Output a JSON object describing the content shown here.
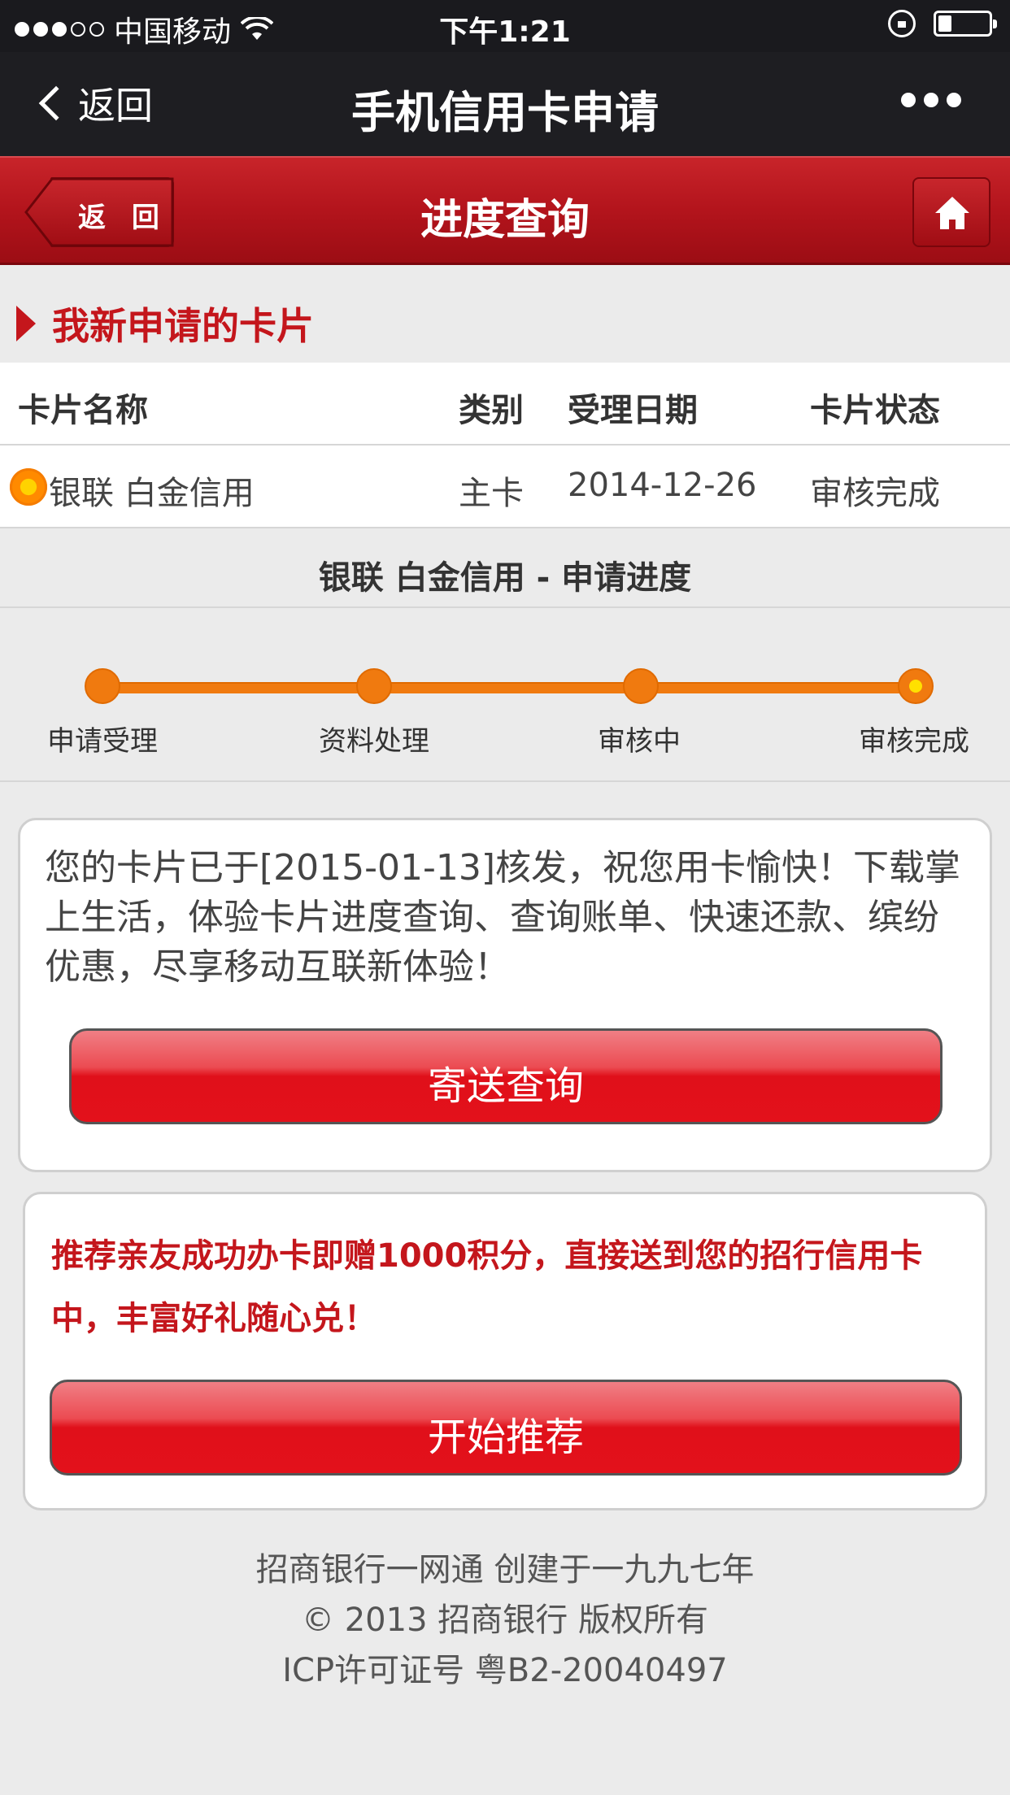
{
  "status_bar": {
    "carrier": "中国移动",
    "time": "下午1:21",
    "signal_bars_filled": 3,
    "signal_bars_total": 5,
    "battery_level": 0.2
  },
  "nav": {
    "back_label": "返回",
    "title": "手机信用卡申请"
  },
  "header": {
    "back_label": "返 回",
    "title": "进度查询"
  },
  "section": {
    "title": "我新申请的卡片"
  },
  "table": {
    "headers": [
      "卡片名称",
      "类别",
      "受理日期",
      "卡片状态"
    ],
    "rows": [
      {
        "name": "银联 白金信用",
        "type": "主卡",
        "date": "2014-12-26",
        "status": "审核完成"
      }
    ]
  },
  "progress": {
    "title": "银联 白金信用 - 申请进度",
    "steps": [
      "申请受理",
      "资料处理",
      "审核中",
      "审核完成"
    ],
    "current_step": 4
  },
  "notice": {
    "message": "您的卡片已于[2015-01-13]核发，祝您用卡愉快！下载掌上生活，体验卡片进度查询、查询账单、快速还款、缤纷优惠，尽享移动互联新体验！",
    "button": "寄送查询"
  },
  "referral": {
    "message": "推荐亲友成功办卡即赠1000积分，直接送到您的招行信用卡中，丰富好礼随心兑！",
    "button": "开始推荐"
  },
  "footer": {
    "line1": "招商银行一网通 创建于一九九七年",
    "line2": "© 2013 招商银行 版权所有",
    "line3": "ICP许可证号 粤B2-20040497"
  },
  "colors": {
    "brand_red": "#c4161c",
    "progress_orange": "#f07a0f"
  }
}
